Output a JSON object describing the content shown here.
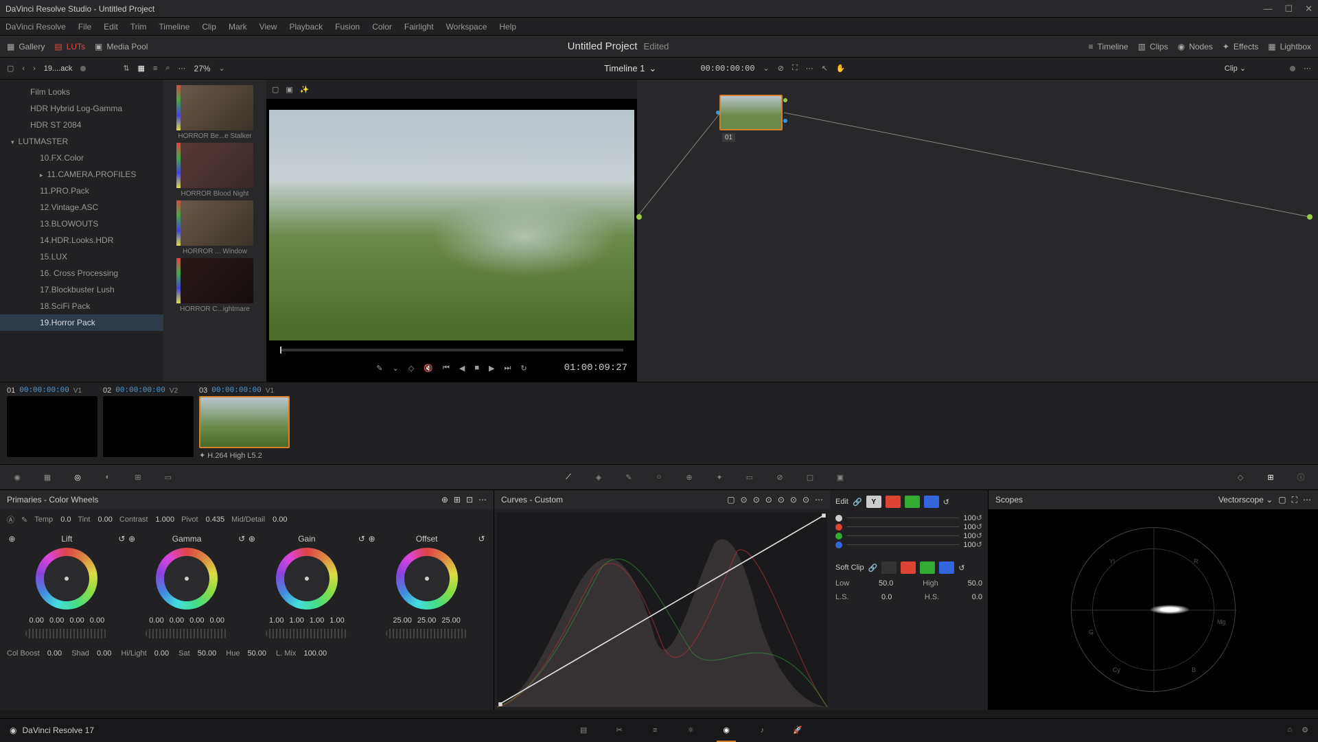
{
  "titlebar": {
    "text": "DaVinci Resolve Studio - Untitled Project"
  },
  "menu": [
    "DaVinci Resolve",
    "File",
    "Edit",
    "Trim",
    "Timeline",
    "Clip",
    "Mark",
    "View",
    "Playback",
    "Fusion",
    "Color",
    "Fairlight",
    "Workspace",
    "Help"
  ],
  "toptool": {
    "gallery": "Gallery",
    "luts": "LUTs",
    "mediapool": "Media Pool",
    "project": "Untitled Project",
    "edited": "Edited",
    "timeline": "Timeline",
    "clips": "Clips",
    "nodes": "Nodes",
    "effects": "Effects",
    "lightbox": "Lightbox"
  },
  "subtool": {
    "crumb": "19....ack",
    "zoom": "27%",
    "timeline_name": "Timeline 1",
    "source_tc": "00:00:00:00",
    "clip_label": "Clip"
  },
  "lut_tree": [
    {
      "label": "Film Looks",
      "cls": "sub"
    },
    {
      "label": "HDR Hybrid Log-Gamma",
      "cls": "sub"
    },
    {
      "label": "HDR ST 2084",
      "cls": "sub"
    },
    {
      "label": "LUTMASTER",
      "cls": "item expand"
    },
    {
      "label": "10.FX.Color",
      "cls": "sub2"
    },
    {
      "label": "11.CAMERA.PROFILES",
      "cls": "sub2 collapse"
    },
    {
      "label": "11.PRO.Pack",
      "cls": "sub2"
    },
    {
      "label": "12.Vintage.ASC",
      "cls": "sub2"
    },
    {
      "label": "13.BLOWOUTS",
      "cls": "sub2"
    },
    {
      "label": "14.HDR.Looks.HDR",
      "cls": "sub2"
    },
    {
      "label": "15.LUX",
      "cls": "sub2"
    },
    {
      "label": "16. Cross Processing",
      "cls": "sub2"
    },
    {
      "label": "17.Blockbuster Lush",
      "cls": "sub2"
    },
    {
      "label": "18.SciFi Pack",
      "cls": "sub2"
    },
    {
      "label": "19.Horror Pack",
      "cls": "sub2 sel"
    }
  ],
  "lut_thumbs": [
    {
      "label": "HORROR Be...e Stalker",
      "cls": "norm"
    },
    {
      "label": "HORROR Blood Night",
      "cls": ""
    },
    {
      "label": "HORROR ... Window",
      "cls": "norm"
    },
    {
      "label": "HORROR C...ightmare",
      "cls": "dark"
    }
  ],
  "viewer": {
    "tc": "01:00:09:27"
  },
  "node": {
    "label": "01"
  },
  "clips": [
    {
      "num": "01",
      "tc": "00:00:00:00",
      "v": "V1",
      "name": "",
      "sel": false,
      "landscape": false
    },
    {
      "num": "02",
      "tc": "00:00:00:00",
      "v": "V2",
      "name": "",
      "sel": false,
      "landscape": false
    },
    {
      "num": "03",
      "tc": "00:00:00:00",
      "v": "V1",
      "name": "H.264 High L5.2",
      "sel": true,
      "landscape": true
    }
  ],
  "primaries": {
    "title": "Primaries - Color Wheels",
    "temp": {
      "label": "Temp",
      "value": "0.0"
    },
    "tint": {
      "label": "Tint",
      "value": "0.00"
    },
    "contrast": {
      "label": "Contrast",
      "value": "1.000"
    },
    "pivot": {
      "label": "Pivot",
      "value": "0.435"
    },
    "middetail": {
      "label": "Mid/Detail",
      "value": "0.00"
    },
    "wheels": [
      {
        "name": "Lift",
        "vals": [
          "0.00",
          "0.00",
          "0.00",
          "0.00"
        ]
      },
      {
        "name": "Gamma",
        "vals": [
          "0.00",
          "0.00",
          "0.00",
          "0.00"
        ]
      },
      {
        "name": "Gain",
        "vals": [
          "1.00",
          "1.00",
          "1.00",
          "1.00"
        ]
      },
      {
        "name": "Offset",
        "vals": [
          "25.00",
          "25.00",
          "25.00"
        ]
      }
    ],
    "bottom": {
      "colboost": {
        "label": "Col Boost",
        "value": "0.00"
      },
      "shad": {
        "label": "Shad",
        "value": "0.00"
      },
      "hilight": {
        "label": "Hi/Light",
        "value": "0.00"
      },
      "sat": {
        "label": "Sat",
        "value": "50.00"
      },
      "hue": {
        "label": "Hue",
        "value": "50.00"
      },
      "lmix": {
        "label": "L. Mix",
        "value": "100.00"
      }
    }
  },
  "curves": {
    "title": "Curves - Custom",
    "edit": "Edit",
    "softclip": "Soft Clip",
    "intensities": [
      "100",
      "100",
      "100",
      "100"
    ],
    "low": {
      "label": "Low",
      "value": "50.0"
    },
    "high": {
      "label": "High",
      "value": "50.0"
    },
    "ls": {
      "label": "L.S.",
      "value": "0.0"
    },
    "hs": {
      "label": "H.S.",
      "value": "0.0"
    }
  },
  "scopes": {
    "title": "Scopes",
    "type": "Vectorscope"
  },
  "bottombar": {
    "version": "DaVinci Resolve 17"
  }
}
